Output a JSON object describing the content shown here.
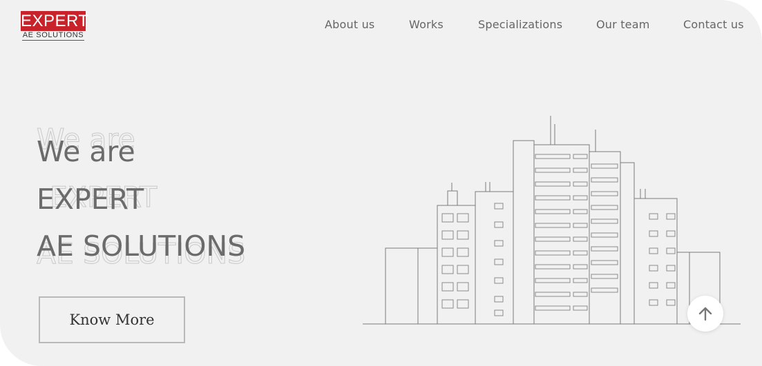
{
  "logo": {
    "top_text": "EXPERT",
    "bottom_text": "AE SOLUTIONS",
    "brand_color": "#c8232a"
  },
  "nav": {
    "items": [
      {
        "label": "About us"
      },
      {
        "label": "Works"
      },
      {
        "label": "Specializations"
      },
      {
        "label": "Our team"
      },
      {
        "label": "Contact us"
      }
    ]
  },
  "hero": {
    "line1": "We are",
    "line2": "EXPERT",
    "line3": "AE SOLUTIONS",
    "cta_label": "Know More"
  },
  "icons": {
    "scroll_top": "arrow-up-icon",
    "illustration": "building-illustration"
  },
  "colors": {
    "background": "#f1f1f2",
    "text": "#6b6b6b",
    "accent": "#c8232a"
  }
}
